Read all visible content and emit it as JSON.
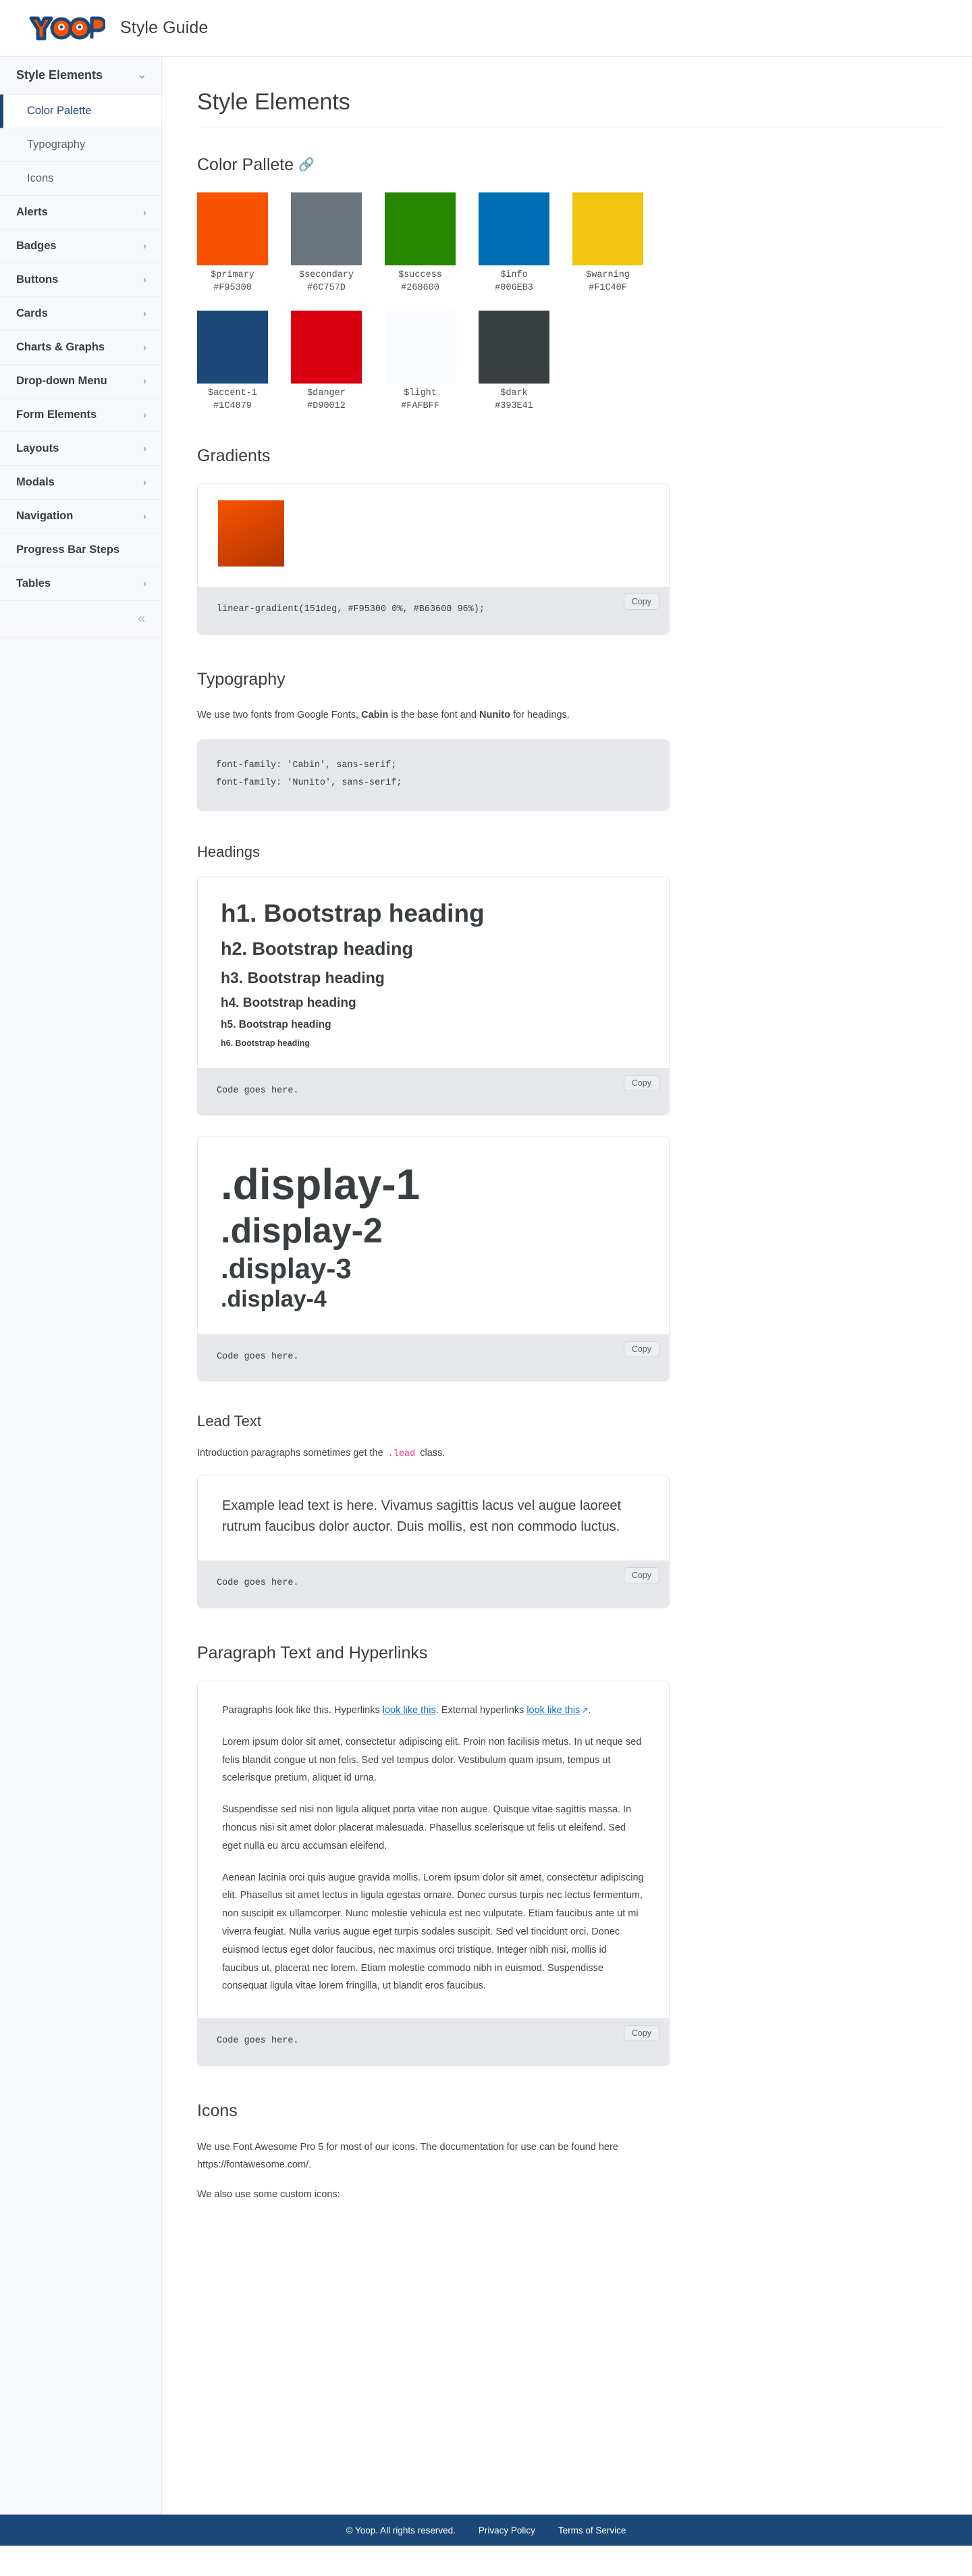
{
  "brand": {
    "logo_text": "YOOP",
    "subtitle": "Style Guide",
    "logo_orange": "#F95300",
    "logo_outline": "#1C4879"
  },
  "sidebar": {
    "group_title": "Style Elements",
    "group_chevron": "chevron-down-icon",
    "sub_items": [
      {
        "label": "Color Palette",
        "active": true
      },
      {
        "label": "Typography",
        "active": false
      },
      {
        "label": "Icons",
        "active": false
      }
    ],
    "items": [
      {
        "label": "Alerts"
      },
      {
        "label": "Badges"
      },
      {
        "label": "Buttons"
      },
      {
        "label": "Cards"
      },
      {
        "label": "Charts & Graphs"
      },
      {
        "label": "Drop-down Menu"
      },
      {
        "label": "Form Elements"
      },
      {
        "label": "Layouts"
      },
      {
        "label": "Modals"
      },
      {
        "label": "Navigation"
      },
      {
        "label": "Progress Bar Steps"
      },
      {
        "label": "Tables"
      }
    ],
    "collapse_icon": "chevron-double-left-icon"
  },
  "main": {
    "page_title": "Style Elements",
    "color_palette": {
      "heading": "Color Pallete",
      "link_icon": "link-icon",
      "row1": [
        {
          "name": "$primary",
          "hex": "#F95300"
        },
        {
          "name": "$secondary",
          "hex": "#6C757D"
        },
        {
          "name": "$success",
          "hex": "#268600"
        },
        {
          "name": "$info",
          "hex": "#006EB3"
        },
        {
          "name": "$warning",
          "hex": "#F1C40F"
        }
      ],
      "row2": [
        {
          "name": "$accent-1",
          "hex": "#1C4879"
        },
        {
          "name": "$danger",
          "hex": "#D90012"
        },
        {
          "name": "$light",
          "hex": "#FAFBFF"
        },
        {
          "name": "$dark",
          "hex": "#393E41"
        }
      ]
    },
    "gradients": {
      "heading": "Gradients",
      "code": "linear-gradient(151deg, #F95300 0%, #B63600 96%);",
      "copy_label": "Copy"
    },
    "typography": {
      "heading": "Typography",
      "note_before": "We use two fonts from Google Fonts, ",
      "note_font1": "Cabin",
      "note_middle": " is the base font and ",
      "note_font2": "Nunito",
      "note_after": " for headings.",
      "code_line1": "font-family: 'Cabin', sans-serif;",
      "code_line2": "font-family: 'Nunito', sans-serif;"
    },
    "headings": {
      "heading": "Headings",
      "samples": [
        "h1. Bootstrap heading",
        "h2. Bootstrap heading",
        "h3. Bootstrap heading",
        "h4. Bootstrap heading",
        "h5. Bootstrap heading",
        "h6. Bootstrap heading"
      ],
      "code": "Code goes here.",
      "copy_label": "Copy"
    },
    "display": {
      "samples": [
        ".display-1",
        ".display-2",
        ".display-3",
        ".display-4"
      ],
      "code": "Code goes here.",
      "copy_label": "Copy"
    },
    "lead_text": {
      "heading": "Lead Text",
      "note_before": "Introduction paragraphs sometimes get the ",
      "note_code": ".lead",
      "note_after": " class.",
      "sample": "Example lead text is here. Vivamus sagittis lacus vel augue laoreet rutrum faucibus dolor auctor. Duis mollis, est non commodo luctus.",
      "code": "Code goes here.",
      "copy_label": "Copy"
    },
    "paragraph": {
      "heading": "Paragraph Text and Hyperlinks",
      "intro_a": "Paragraphs look like this. Hyperlinks ",
      "intro_link1": "look like this",
      "intro_b": ". External hyperlinks ",
      "intro_link2": "look like this",
      "intro_ext_icon": "external-link-icon",
      "intro_c": ".",
      "p1": "Lorem ipsum dolor sit amet, consectetur adipiscing elit. Proin non facilisis metus. In ut neque sed felis blandit congue ut non felis. Sed vel tempus dolor. Vestibulum quam ipsum, tempus ut scelerisque pretium, aliquet id urna.",
      "p2": "Suspendisse sed nisi non ligula aliquet porta vitae non augue. Quisque vitae sagittis massa. In rhoncus nisi sit amet dolor placerat malesuada. Phasellus scelerisque ut felis ut eleifend. Sed eget nulla eu arcu accumsan eleifend.",
      "p3": "Aenean lacinia orci quis augue gravida mollis. Lorem ipsum dolor sit amet, consectetur adipiscing elit. Phasellus sit amet lectus in ligula egestas ornare. Donec cursus turpis nec lectus fermentum, non suscipit ex ullamcorper. Nunc molestie vehicula est nec vulputate. Etiam faucibus ante ut mi viverra feugiat. Nulla varius augue eget turpis sodales suscipit. Sed vel tincidunt orci. Donec euismod lectus eget dolor faucibus, nec maximus orci tristique. Integer nibh nisi, mollis id faucibus ut, placerat nec lorem. Etiam molestie commodo nibh in euismod. Suspendisse consequat ligula vitae lorem fringilla, ut blandit eros faucibus.",
      "code": "Code goes here.",
      "copy_label": "Copy"
    },
    "icons": {
      "heading": "Icons",
      "note1": "We use Font Awesome Pro 5 for most of our icons. The documentation for use can be found here https://fontawesome.com/.",
      "note2": "We also use some custom icons:"
    }
  },
  "footer": {
    "copyright": "© Yoop. All rights reserved.",
    "privacy": "Privacy Policy",
    "terms": "Terms of Service",
    "bg": "#1C4879"
  }
}
